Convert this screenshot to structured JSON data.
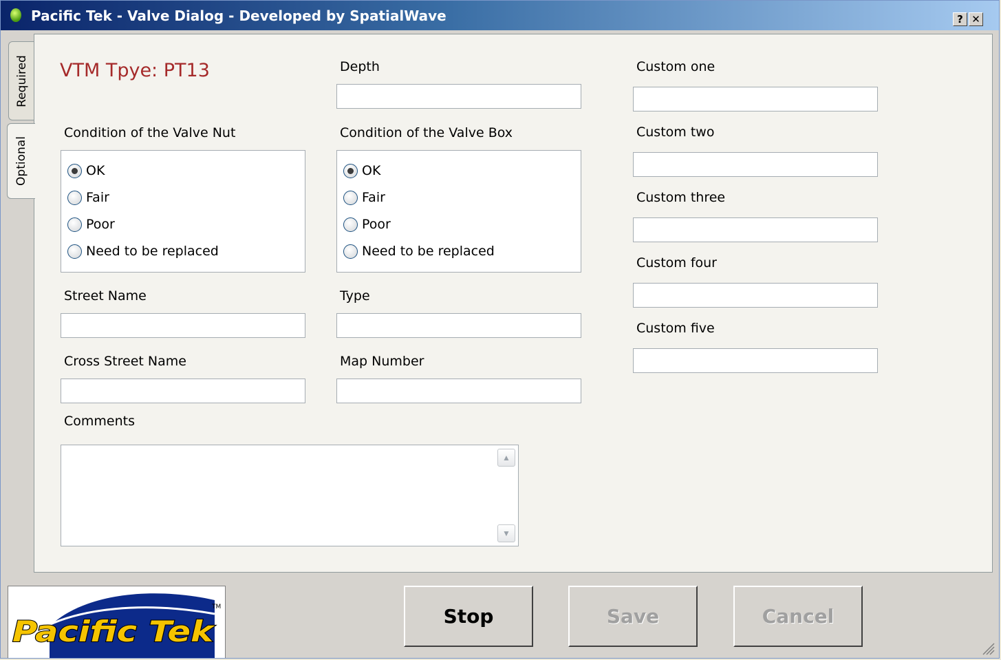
{
  "window": {
    "title": "Pacific Tek - Valve Dialog - Developed by SpatialWave",
    "help_btn": "?",
    "close_btn": "✕"
  },
  "tabs": {
    "required": "Required",
    "optional": "Optional"
  },
  "vtm_type": "VTM Tpye: PT13",
  "fields": {
    "depth": "Depth",
    "condition_nut": "Condition of the Valve Nut",
    "condition_box": "Condition of the Valve Box",
    "street_name": "Street Name",
    "type": "Type",
    "cross_street_name": "Cross Street Name",
    "map_number": "Map Number",
    "comments": "Comments",
    "custom_one": "Custom one",
    "custom_two": "Custom two",
    "custom_three": "Custom three",
    "custom_four": "Custom four",
    "custom_five": "Custom five"
  },
  "radio_options": [
    "OK",
    "Fair",
    "Poor",
    "Need to be replaced"
  ],
  "selected": {
    "nut": "OK",
    "box": "OK"
  },
  "buttons": {
    "stop": "Stop",
    "save": "Save",
    "cancel": "Cancel"
  },
  "logo": {
    "text": "Pacific Tek",
    "tm": "TM"
  },
  "colors": {
    "vtm_text": "#a52a2a",
    "titlebar_start": "#0a246a",
    "titlebar_end": "#a6caf0",
    "panel_bg": "#f4f3ee",
    "chrome_bg": "#d6d3ce"
  }
}
